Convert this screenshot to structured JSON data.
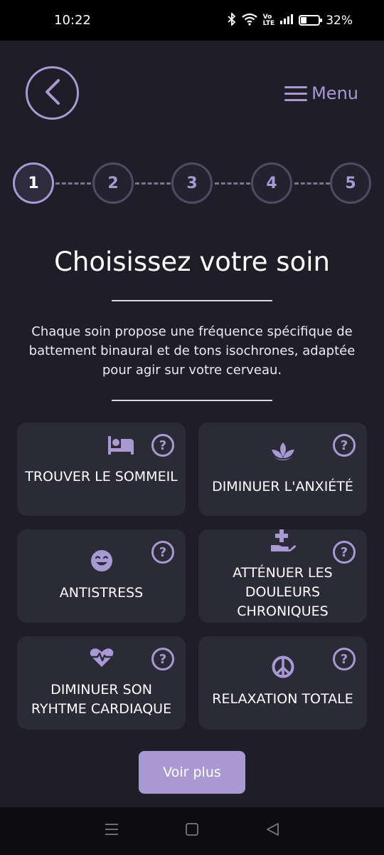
{
  "status_bar": {
    "time": "10:22",
    "battery": "32%",
    "icons": [
      "bluetooth-icon",
      "wifi-icon",
      "volte-icon",
      "signal-icon",
      "battery-icon"
    ]
  },
  "header": {
    "back_icon": "chevron-left-icon",
    "menu_label": "Menu",
    "menu_icon": "hamburger-icon"
  },
  "stepper": {
    "steps": [
      "1",
      "2",
      "3",
      "4",
      "5"
    ],
    "active": "1"
  },
  "main": {
    "title": "Choisissez votre soin",
    "description": "Chaque soin propose une fréquence spécifique de battement binaural et de tons isochrones, adaptée pour agir sur votre cerveau."
  },
  "cards": [
    {
      "label": "TROUVER LE SOMMEIL",
      "icon": "bed-icon"
    },
    {
      "label": "DIMINUER L'ANXIÉTÉ",
      "icon": "lotus-icon"
    },
    {
      "label": "ANTISTRESS",
      "icon": "smile-icon"
    },
    {
      "label": "ATTÉNUER LES DOULEURS CHRONIQUES",
      "icon": "hand-medical-icon"
    },
    {
      "label": "DIMINUER SON RYHTME CARDIAQUE",
      "icon": "heartbeat-icon"
    },
    {
      "label": "RELAXATION TOTALE",
      "icon": "peace-icon"
    }
  ],
  "help_symbol": "?",
  "more_button": "Voir plus",
  "nav_bar": {
    "icons": [
      "recents-icon",
      "home-icon",
      "back-icon"
    ]
  },
  "colors": {
    "accent": "#a899d2",
    "background": "#1e1d28",
    "card": "#2b2a37"
  }
}
